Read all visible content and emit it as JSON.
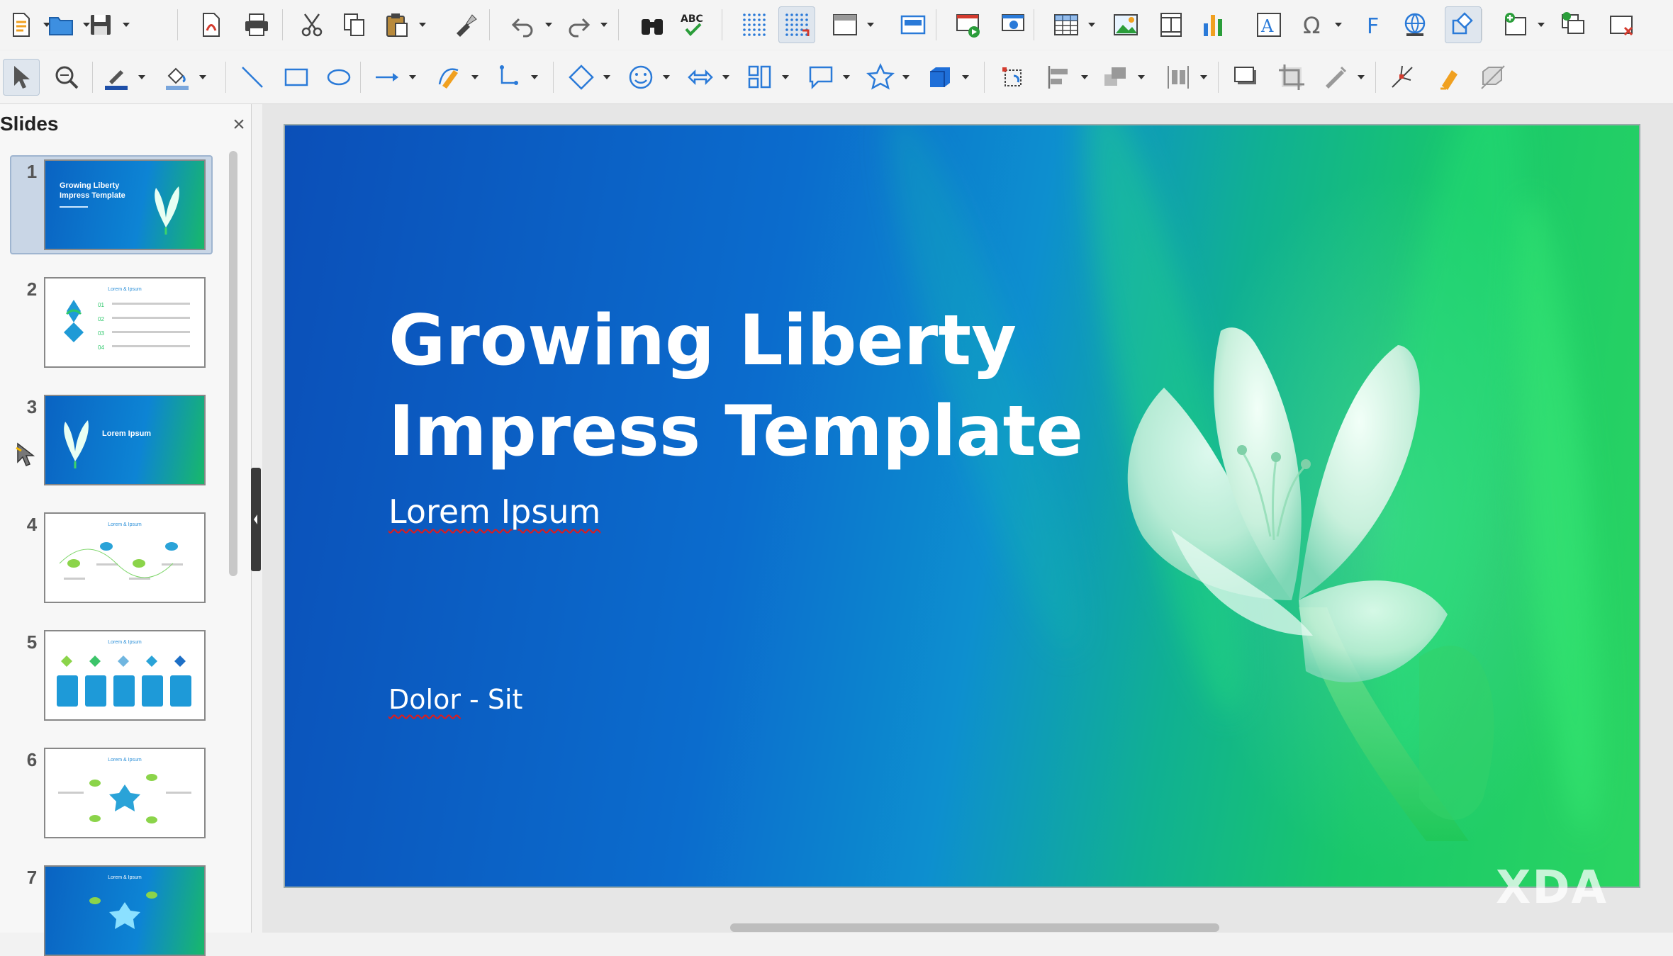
{
  "toolbar_row1": [
    {
      "name": "new-icon",
      "dd": true
    },
    {
      "name": "open-icon",
      "dd": true
    },
    {
      "name": "save-icon",
      "dd": true
    },
    {
      "name": "export-pdf-icon"
    },
    {
      "name": "print-icon"
    },
    {
      "name": "cut-icon"
    },
    {
      "name": "copy-icon"
    },
    {
      "name": "paste-icon",
      "dd": true
    },
    {
      "name": "clone-formatting-icon"
    },
    {
      "name": "undo-icon",
      "dd": true
    },
    {
      "name": "redo-icon",
      "dd": true
    },
    {
      "name": "find-replace-icon"
    },
    {
      "name": "spelling-icon"
    },
    {
      "name": "display-grid-icon"
    },
    {
      "name": "snap-to-grid-icon"
    },
    {
      "name": "display-views-icon",
      "dd": true
    },
    {
      "name": "master-slide-icon"
    },
    {
      "name": "start-first-slide-icon"
    },
    {
      "name": "start-current-slide-icon"
    },
    {
      "name": "insert-table-icon",
      "dd": true
    },
    {
      "name": "insert-image-icon"
    },
    {
      "name": "insert-media-icon"
    },
    {
      "name": "insert-chart-icon"
    },
    {
      "name": "insert-textbox-icon"
    },
    {
      "name": "special-character-icon",
      "dd": true
    },
    {
      "name": "fontwork-icon"
    },
    {
      "name": "hyperlink-icon"
    },
    {
      "name": "show-draw-functions-icon"
    },
    {
      "name": "new-slide-icon",
      "dd": true
    },
    {
      "name": "duplicate-slide-icon"
    },
    {
      "name": "delete-slide-icon"
    }
  ],
  "toolbar_row2": [
    {
      "name": "select-icon"
    },
    {
      "name": "zoom-pan-icon"
    },
    {
      "name": "line-color-icon",
      "dd": true
    },
    {
      "name": "fill-color-icon",
      "dd": true
    },
    {
      "name": "line-icon"
    },
    {
      "name": "rectangle-icon"
    },
    {
      "name": "ellipse-icon"
    },
    {
      "name": "line-ends-arrow-icon",
      "dd": true
    },
    {
      "name": "curve-icon",
      "dd": true
    },
    {
      "name": "connector-icon",
      "dd": true
    },
    {
      "name": "basic-shapes-icon",
      "dd": true
    },
    {
      "name": "symbol-shapes-icon",
      "dd": true
    },
    {
      "name": "block-arrows-icon",
      "dd": true
    },
    {
      "name": "flowchart-icon",
      "dd": true
    },
    {
      "name": "callout-icon",
      "dd": true
    },
    {
      "name": "star-icon",
      "dd": true
    },
    {
      "name": "3d-object-icon",
      "dd": true
    },
    {
      "name": "rotate-icon"
    },
    {
      "name": "align-objects-icon",
      "dd": true
    },
    {
      "name": "arrange-icon",
      "dd": true
    },
    {
      "name": "distribute-icon",
      "dd": true
    },
    {
      "name": "shadow-icon"
    },
    {
      "name": "crop-image-icon"
    },
    {
      "name": "filter-icon",
      "dd": true
    },
    {
      "name": "points-icon"
    },
    {
      "name": "glue-points-icon"
    },
    {
      "name": "toggle-extrusion-icon"
    }
  ],
  "slides_pane": {
    "title": "Slides",
    "close": "×",
    "slides": [
      {
        "num": "1",
        "style": "blue",
        "title_lines": "Growing Liberty\nImpress Template",
        "selected": true
      },
      {
        "num": "2",
        "style": "white",
        "header": "Lorem & Ipsum"
      },
      {
        "num": "3",
        "style": "blue",
        "title_lines": "Lorem Ipsum"
      },
      {
        "num": "4",
        "style": "white",
        "header": "Lorem & Ipsum"
      },
      {
        "num": "5",
        "style": "white",
        "header": "Lorem & Ipsum"
      },
      {
        "num": "6",
        "style": "white",
        "header": "Lorem & Ipsum"
      },
      {
        "num": "7",
        "style": "blue",
        "header": "Lorem & Ipsum"
      }
    ]
  },
  "slide": {
    "title_line1": "Growing Liberty",
    "title_line2": "Impress Template",
    "subtitle": "Lorem Ipsum",
    "footer_a": "Dolor",
    "footer_sep": " - ",
    "footer_b": "Sit"
  },
  "watermark": "XDA",
  "colors": {
    "accent": "#2a7ad8",
    "slide_blue": "#0b5fc2",
    "slide_green": "#22cf62"
  }
}
